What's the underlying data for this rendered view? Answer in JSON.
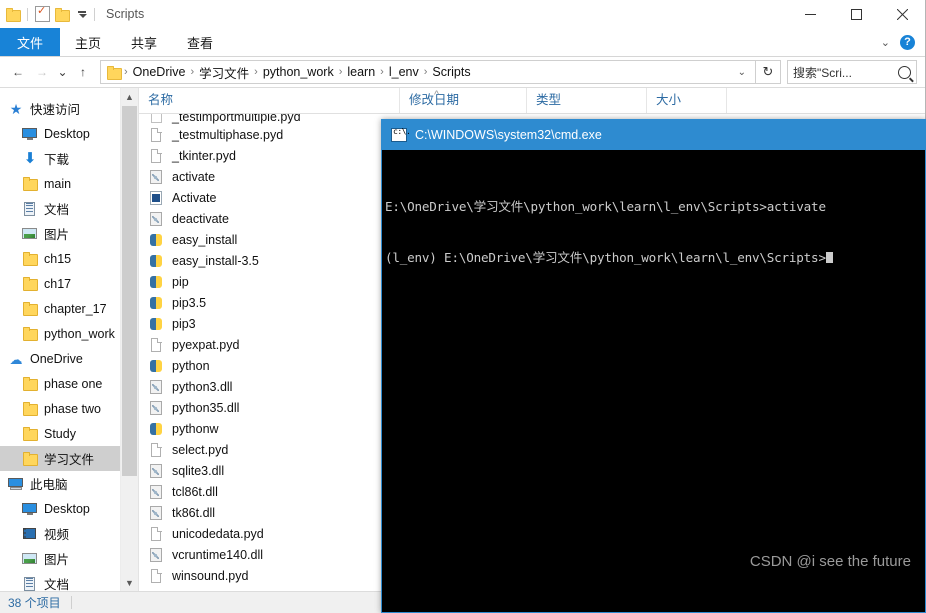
{
  "window": {
    "title": "Scripts",
    "quick_access_icons": [
      "folder-icon",
      "properties-icon",
      "new-folder-icon",
      "customize-qat-caret"
    ],
    "controls": {
      "minimize": "–",
      "maximize": "□",
      "close": "✕"
    }
  },
  "ribbon": {
    "tabs": [
      {
        "label": "文件",
        "active": true
      },
      {
        "label": "主页",
        "active": false
      },
      {
        "label": "共享",
        "active": false
      },
      {
        "label": "查看",
        "active": false
      }
    ],
    "collapse_caret": "⌄",
    "help_label": "?"
  },
  "address_bar": {
    "back": "←",
    "forward": "→",
    "recent": "⌄",
    "up": "↑",
    "crumbs": [
      "OneDrive",
      "学习文件",
      "python_work",
      "learn",
      "l_env",
      "Scripts"
    ],
    "separator": "›",
    "dropdown_caret": "⌄",
    "refresh": "↻",
    "search_placeholder": "搜索\"Scri...",
    "search_value": ""
  },
  "nav_pane": {
    "items": [
      {
        "label": "快速访问",
        "icon": "star-icon",
        "indent": 0,
        "pinned": false,
        "selected": false
      },
      {
        "label": "Desktop",
        "icon": "monitor-icon",
        "indent": 1,
        "pinned": true,
        "selected": false
      },
      {
        "label": "下载",
        "icon": "download-icon",
        "indent": 1,
        "pinned": true,
        "selected": false
      },
      {
        "label": "main",
        "icon": "folder-icon",
        "indent": 1,
        "pinned": true,
        "selected": false
      },
      {
        "label": "文档",
        "icon": "documents-icon",
        "indent": 1,
        "pinned": true,
        "selected": false
      },
      {
        "label": "图片",
        "icon": "pictures-icon",
        "indent": 1,
        "pinned": true,
        "selected": false
      },
      {
        "label": "ch15",
        "icon": "folder-icon",
        "indent": 1,
        "pinned": false,
        "selected": false
      },
      {
        "label": "ch17",
        "icon": "folder-icon",
        "indent": 1,
        "pinned": false,
        "selected": false
      },
      {
        "label": "chapter_17",
        "icon": "folder-icon",
        "indent": 1,
        "pinned": false,
        "selected": false
      },
      {
        "label": "python_work",
        "icon": "folder-icon",
        "indent": 1,
        "pinned": false,
        "selected": false
      },
      {
        "label": "OneDrive",
        "icon": "cloud-icon",
        "indent": 0,
        "pinned": false,
        "selected": false
      },
      {
        "label": "phase one",
        "icon": "folder-icon",
        "indent": 1,
        "pinned": false,
        "selected": false
      },
      {
        "label": "phase two",
        "icon": "folder-icon",
        "indent": 1,
        "pinned": false,
        "selected": false
      },
      {
        "label": "Study",
        "icon": "folder-icon",
        "indent": 1,
        "pinned": false,
        "selected": false
      },
      {
        "label": "学习文件",
        "icon": "folder-icon",
        "indent": 1,
        "pinned": false,
        "selected": true
      },
      {
        "label": "此电脑",
        "icon": "this-pc-icon",
        "indent": 0,
        "pinned": false,
        "selected": false
      },
      {
        "label": "Desktop",
        "icon": "monitor-icon",
        "indent": 1,
        "pinned": false,
        "selected": false
      },
      {
        "label": "视频",
        "icon": "videos-icon",
        "indent": 1,
        "pinned": false,
        "selected": false
      },
      {
        "label": "图片",
        "icon": "pictures-icon",
        "indent": 1,
        "pinned": false,
        "selected": false
      },
      {
        "label": "文档",
        "icon": "documents-icon",
        "indent": 1,
        "pinned": false,
        "selected": false
      }
    ]
  },
  "file_pane": {
    "columns": [
      {
        "label": "名称",
        "key": "name"
      },
      {
        "label": "修改日期",
        "key": "date"
      },
      {
        "label": "类型",
        "key": "type"
      },
      {
        "label": "大小",
        "key": "size"
      }
    ],
    "sort_indicator": "^",
    "rows": [
      {
        "name": "_testimportmultiple.pyd",
        "icon": "file-icon",
        "clipped": true
      },
      {
        "name": "_testmultiphase.pyd",
        "icon": "file-icon"
      },
      {
        "name": "_tkinter.pyd",
        "icon": "file-icon"
      },
      {
        "name": "activate",
        "icon": "dll-icon"
      },
      {
        "name": "Activate",
        "icon": "powershell-script-icon"
      },
      {
        "name": "deactivate",
        "icon": "dll-icon"
      },
      {
        "name": "easy_install",
        "icon": "python-exe-icon"
      },
      {
        "name": "easy_install-3.5",
        "icon": "python-exe-icon"
      },
      {
        "name": "pip",
        "icon": "python-exe-icon"
      },
      {
        "name": "pip3.5",
        "icon": "python-exe-icon"
      },
      {
        "name": "pip3",
        "icon": "python-exe-icon"
      },
      {
        "name": "pyexpat.pyd",
        "icon": "file-icon"
      },
      {
        "name": "python",
        "icon": "python-exe-icon"
      },
      {
        "name": "python3.dll",
        "icon": "dll-icon"
      },
      {
        "name": "python35.dll",
        "icon": "dll-icon"
      },
      {
        "name": "pythonw",
        "icon": "python-exe-icon"
      },
      {
        "name": "select.pyd",
        "icon": "file-icon"
      },
      {
        "name": "sqlite3.dll",
        "icon": "dll-icon"
      },
      {
        "name": "tcl86t.dll",
        "icon": "dll-icon"
      },
      {
        "name": "tk86t.dll",
        "icon": "dll-icon"
      },
      {
        "name": "unicodedata.pyd",
        "icon": "file-icon"
      },
      {
        "name": "vcruntime140.dll",
        "icon": "dll-icon"
      },
      {
        "name": "winsound.pyd",
        "icon": "file-icon"
      }
    ]
  },
  "status_bar": {
    "item_count": "38 个项目"
  },
  "cmd": {
    "title": "C:\\WINDOWS\\system32\\cmd.exe",
    "title_color": "#2e8bd0",
    "background": "#000000",
    "text_color": "#cccccc",
    "lines": [
      "E:\\OneDrive\\学习文件\\python_work\\learn\\l_env\\Scripts>activate",
      "(l_env) E:\\OneDrive\\学习文件\\python_work\\learn\\l_env\\Scripts>"
    ],
    "watermark": "CSDN @i see the future"
  }
}
